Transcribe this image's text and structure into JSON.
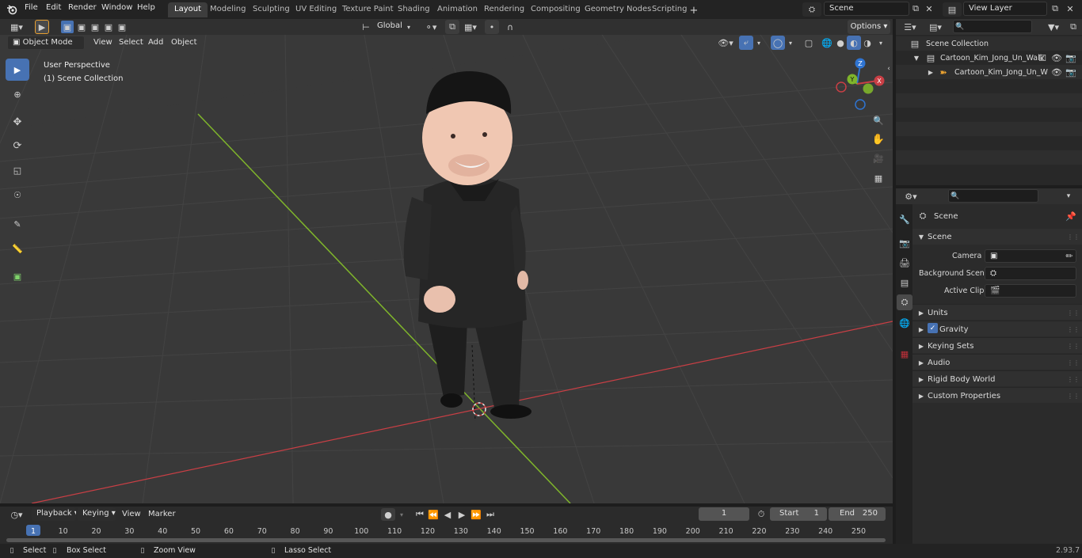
{
  "menu": {
    "file": "File",
    "edit": "Edit",
    "render": "Render",
    "window": "Window",
    "help": "Help"
  },
  "workspaces": [
    "Layout",
    "Modeling",
    "Sculpting",
    "UV Editing",
    "Texture Paint",
    "Shading",
    "Animation",
    "Rendering",
    "Compositing",
    "Geometry Nodes",
    "Scripting"
  ],
  "active_workspace": "Layout",
  "scene_field": "Scene",
  "view_layer_field": "View Layer",
  "tool_header": {
    "mode": "Object Mode",
    "view": "View",
    "select": "Select",
    "add": "Add",
    "object": "Object",
    "transform": "Global",
    "options": "Options"
  },
  "viewport": {
    "perspective": "User Perspective",
    "collection": "(1) Scene Collection"
  },
  "outliner": {
    "root": "Scene Collection",
    "collection": "Cartoon_Kim_Jong_Un_Walk",
    "object": "Cartoon_Kim_Jong_Un_W"
  },
  "properties": {
    "breadcrumb": "Scene",
    "panel_title": "Scene",
    "camera_label": "Camera",
    "background_label": "Background Scene",
    "clip_label": "Active Clip",
    "sections": [
      "Units",
      "Gravity",
      "Keying Sets",
      "Audio",
      "Rigid Body World",
      "Custom Properties"
    ]
  },
  "timeline": {
    "playback": "Playback",
    "keying": "Keying",
    "view": "View",
    "marker": "Marker",
    "current_frame": "1",
    "start_label": "Start",
    "start_value": "1",
    "end_label": "End",
    "end_value": "250",
    "ticks": [
      "1",
      "10",
      "20",
      "30",
      "40",
      "50",
      "60",
      "70",
      "80",
      "90",
      "100",
      "110",
      "120",
      "130",
      "140",
      "150",
      "160",
      "170",
      "180",
      "190",
      "200",
      "210",
      "220",
      "230",
      "240",
      "250"
    ]
  },
  "status": {
    "select": "Select",
    "box_select": "Box Select",
    "zoom_view": "Zoom View",
    "lasso_select": "Lasso Select",
    "version": "2.93.7"
  },
  "gizmo": {
    "x": "X",
    "y": "Y",
    "z": "Z"
  },
  "colors": {
    "accent": "#4772b3",
    "x_axis": "#c93f45",
    "y_axis": "#7fb52b",
    "z_axis": "#2f74d1"
  }
}
